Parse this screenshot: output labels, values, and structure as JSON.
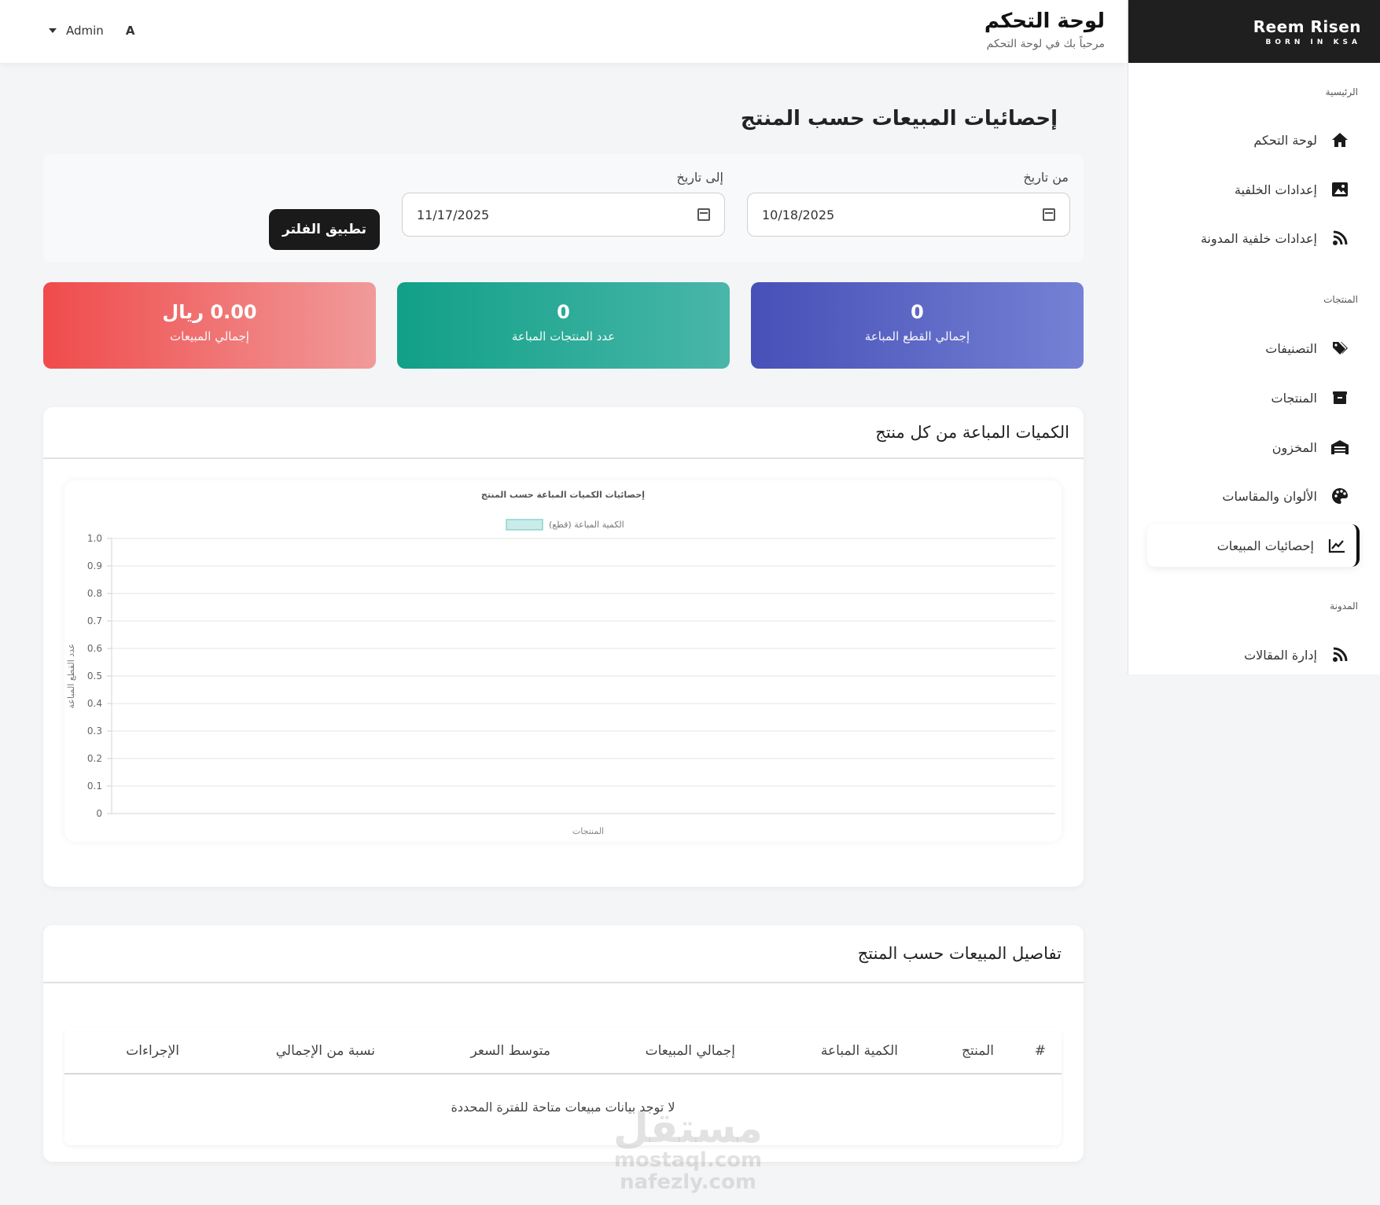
{
  "brand": {
    "name": "Reem Risen",
    "tagline": "BORN IN KSA"
  },
  "header": {
    "title": "لوحة التحكم",
    "subtitle": "مرحباً بك في لوحة التحكم",
    "user_name": "Admin",
    "avatar_letter": "A"
  },
  "sidebar": {
    "sections": [
      {
        "title": "الرئيسية"
      },
      {
        "title": "المنتجات"
      },
      {
        "title": "المدونة"
      }
    ],
    "items": [
      {
        "label": "لوحة التحكم",
        "icon": "home-icon"
      },
      {
        "label": "إعدادات الخلفية",
        "icon": "image-icon"
      },
      {
        "label": "إعدادات خلفية المدونة",
        "icon": "blog-icon"
      },
      {
        "label": "التصنيفات",
        "icon": "tags-icon"
      },
      {
        "label": "المنتجات",
        "icon": "box-icon"
      },
      {
        "label": "المخزون",
        "icon": "warehouse-icon"
      },
      {
        "label": "الألوان والمقاسات",
        "icon": "palette-icon"
      },
      {
        "label": "إحصائيات المبيعات",
        "icon": "chart-line-icon",
        "active": true
      },
      {
        "label": "إدارة المقالات",
        "icon": "blog-icon"
      }
    ]
  },
  "main": {
    "title": "إحصائيات المبيعات حسب المنتج",
    "filter": {
      "from_label": "من تاريخ",
      "from_value": "10/18/2025",
      "to_label": "إلى تاريخ",
      "to_value": "11/17/2025",
      "apply_label": "تطبيق الفلتر"
    },
    "stats": [
      {
        "value": "0",
        "label": "إجمالي القطع المباعة"
      },
      {
        "value": "0",
        "label": "عدد المنتجات المباعة"
      },
      {
        "value": "0.00 ريال",
        "label": "إجمالي المبيعات"
      }
    ],
    "chart_card_title": "الكميات المباعة من كل منتج",
    "table": {
      "title": "تفاصيل المبيعات حسب المنتج",
      "columns": [
        "#",
        "المنتج",
        "الكمية المباعة",
        "إجمالي المبيعات",
        "متوسط السعر",
        "نسبة من الإجمالي",
        "الإجراءات"
      ],
      "empty_message": "لا توجد بيانات مبيعات متاحة للفترة المحددة"
    }
  },
  "watermark": {
    "line1": "مستقل",
    "line2": "mostaql.com",
    "line3": "nafezly.com"
  },
  "chart_data": {
    "type": "bar",
    "title": "إحصائيات الكميات المباعة حسب المنتج",
    "xlabel": "المنتجات",
    "ylabel": "عدد القطع المباعة",
    "ylim": [
      0,
      1
    ],
    "yticks": [
      "1.0",
      "0.9",
      "0.8",
      "0.7",
      "0.6",
      "0.5",
      "0.4",
      "0.3",
      "0.2",
      "0.1",
      "0"
    ],
    "categories": [],
    "series": [
      {
        "name": "الكمية المباعة (قطع)",
        "values": [],
        "color": "#c9ecea"
      }
    ],
    "grid": true,
    "legend": "top"
  }
}
